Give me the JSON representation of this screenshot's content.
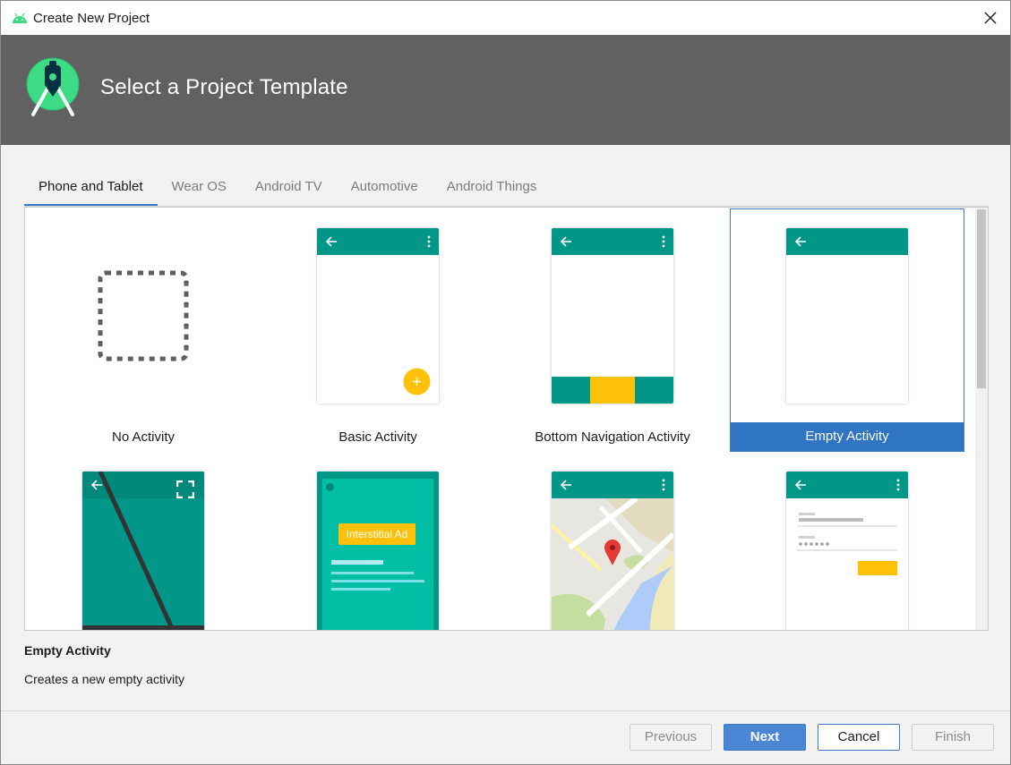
{
  "window": {
    "title": "Create New Project"
  },
  "banner": {
    "heading": "Select a Project Template"
  },
  "tabs": [
    {
      "label": "Phone and Tablet",
      "active": true
    },
    {
      "label": "Wear OS",
      "active": false
    },
    {
      "label": "Android TV",
      "active": false
    },
    {
      "label": "Automotive",
      "active": false
    },
    {
      "label": "Android Things",
      "active": false
    }
  ],
  "templates": [
    {
      "label": "No Activity"
    },
    {
      "label": "Basic Activity"
    },
    {
      "label": "Bottom Navigation Activity"
    },
    {
      "label": "Empty Activity",
      "selected": true
    },
    {
      "label": ""
    },
    {
      "label": "",
      "ad_text": "Interstitial Ad"
    },
    {
      "label": ""
    },
    {
      "label": ""
    }
  ],
  "info": {
    "title": "Empty Activity",
    "description": "Creates a new empty activity"
  },
  "buttons": {
    "previous": "Previous",
    "next": "Next",
    "cancel": "Cancel",
    "finish": "Finish"
  },
  "colors": {
    "banner": "#616161",
    "teal": "#009688",
    "accent_yellow": "#FFC107",
    "selection": "#2F75C3",
    "android_green": "#3DDC84"
  }
}
